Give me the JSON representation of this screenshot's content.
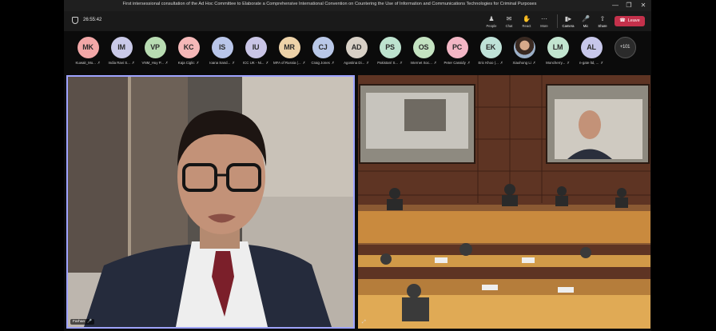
{
  "window": {
    "title": "First intersessional consultation of the Ad Hoc Committee to Elaborate a Comprehensive International Convention on Countering the Use of Information and Communications Technologies for Criminal Purposes",
    "controls": {
      "minimize": "—",
      "maximize": "❐",
      "close": "✕"
    }
  },
  "toolbar": {
    "timer": "26:55:42",
    "people_label": "People",
    "chat_label": "Chat",
    "react_label": "React",
    "more_label": "More",
    "camera_label": "Camera",
    "mic_label": "Mic",
    "share_label": "Share",
    "leave_label": "Leave",
    "icons": {
      "people": "people-icon",
      "chat": "chat-icon",
      "react": "react-icon",
      "more": "more-icon",
      "camera": "camera-icon",
      "mic": "mic-icon",
      "share": "share-icon",
      "leave": "phone-hangup-icon"
    }
  },
  "participants": [
    {
      "initials": "MK",
      "name": "Kuwait_Mo...",
      "color": "#f2a7a7"
    },
    {
      "initials": "IM",
      "name": "India Ravi S...",
      "color": "#c9c9e8"
    },
    {
      "initials": "VP",
      "name": "VNM_Huy P...",
      "color": "#b8dcb2"
    },
    {
      "initials": "KC",
      "name": "Kaja Ciglic",
      "color": "#f5b8b8"
    },
    {
      "initials": "IS",
      "name": "Ioana Sand...",
      "color": "#b9c6ea"
    },
    {
      "initials": "IU",
      "name": "ICC UK - Ni...",
      "color": "#c9c5e6"
    },
    {
      "initials": "MR",
      "name": "MFA of Russia (...",
      "color": "#eed3a9"
    },
    {
      "initials": "CJ",
      "name": "Craig Jones",
      "color": "#b9c8e8"
    },
    {
      "initials": "AD",
      "name": "Agostina Di...",
      "color": "#d8d0c6"
    },
    {
      "initials": "PS",
      "name": "Pakistan/ S...",
      "color": "#bde3cf"
    },
    {
      "initials": "OS",
      "name": "Internet Soc...",
      "color": "#c4e3c1"
    },
    {
      "initials": "PC",
      "name": "Peter Cassidy",
      "color": "#f3b6c5"
    },
    {
      "initials": "EK",
      "name": "Eric Khoo (...",
      "color": "#bfe2d8"
    },
    {
      "initials": "",
      "name": "Xiaohong Li",
      "color": "#9cb0c8",
      "photo": true
    },
    {
      "initials": "LM",
      "name": "Moncherry...",
      "color": "#c2e5d0"
    },
    {
      "initials": "AL",
      "name": "n-gate ltd, ...",
      "color": "#c7c7ea"
    }
  ],
  "overflow_count": "+101",
  "video": {
    "speaker_name": "Farhan",
    "room_feed": "conference-room"
  }
}
